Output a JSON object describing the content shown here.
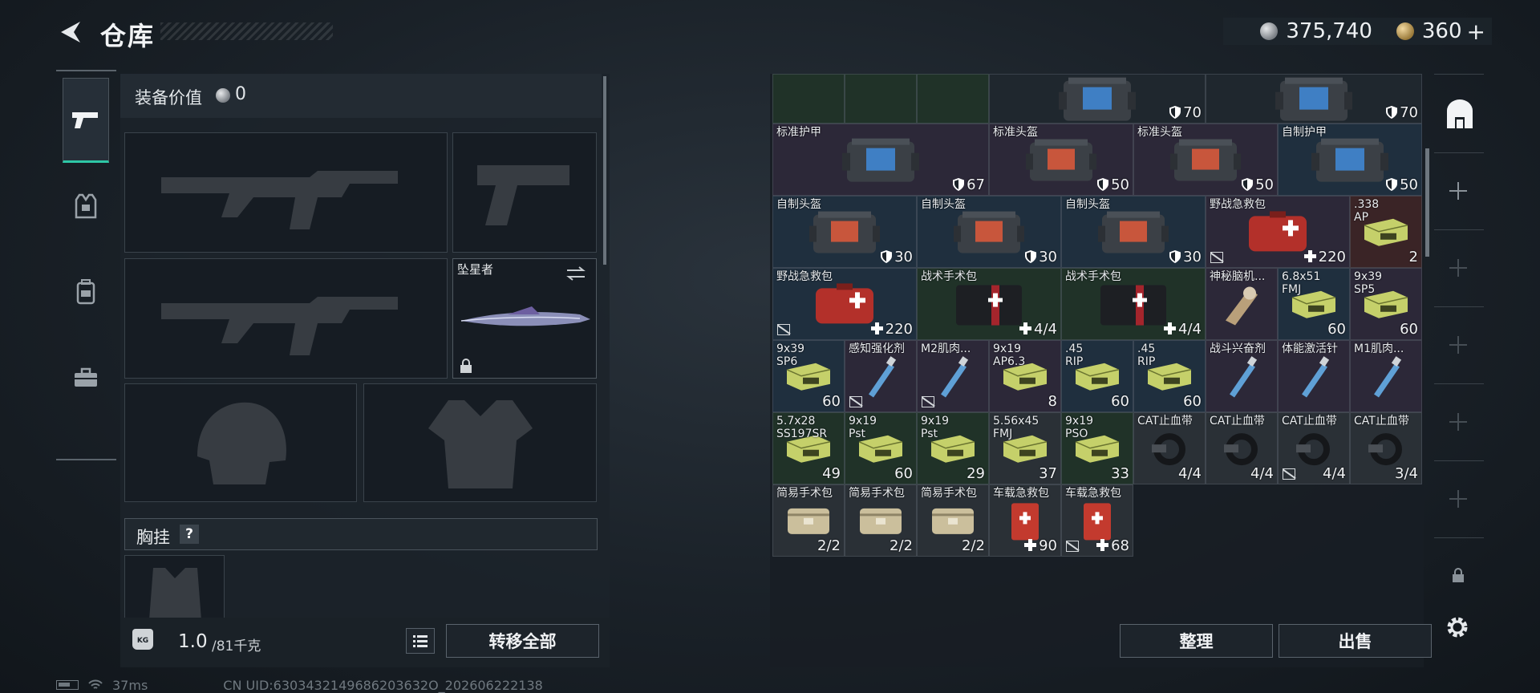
{
  "header": {
    "title": "仓库"
  },
  "currency": {
    "silver_amount": "375,740",
    "gold_amount": "360",
    "gold_plus": "+"
  },
  "equipment": {
    "value_label": "装备价值",
    "value": "0",
    "melee_name": "坠星者",
    "chest_label": "胸挂",
    "help_mark": "?"
  },
  "footer": {
    "weight_icon_text": "KG",
    "weight_current": "1.0",
    "weight_max": "/81千克",
    "transfer_all": "转移全部",
    "sort": "整理",
    "sell": "出售"
  },
  "status": {
    "ping": "37ms",
    "uid": "CN UID:6303432149686203632O_202606222138"
  },
  "storage": {
    "items": [
      {
        "name": "",
        "count": "",
        "bg": "green"
      },
      {
        "name": "",
        "count": "",
        "bg": "green"
      },
      {
        "name": "",
        "count": "",
        "bg": "green"
      },
      {
        "name": "",
        "count": "70",
        "bg": "default",
        "icon": "armor-icon",
        "badge": "shield"
      },
      {
        "name": "",
        "count": "70",
        "bg": "default",
        "icon": "armor-icon",
        "badge": "shield"
      },
      {
        "name": "标准护甲",
        "count": "67",
        "bg": "purple",
        "icon": "armor-icon",
        "badge": "shield"
      },
      {
        "name": "标准头盔",
        "count": "50",
        "bg": "purple",
        "icon": "helmet-icon",
        "badge": "shield"
      },
      {
        "name": "标准头盔",
        "count": "50",
        "bg": "purple",
        "icon": "helmet-icon",
        "badge": "shield"
      },
      {
        "name": "自制护甲",
        "count": "50",
        "bg": "blue",
        "icon": "armor-icon",
        "badge": "shield"
      },
      {
        "name": "自制头盔",
        "count": "30",
        "bg": "blue",
        "icon": "helmet-icon",
        "badge": "shield"
      },
      {
        "name": "自制头盔",
        "count": "30",
        "bg": "blue",
        "icon": "helmet-icon",
        "badge": "shield"
      },
      {
        "name": "自制头盔",
        "count": "30",
        "bg": "blue",
        "icon": "helmet-icon",
        "badge": "shield"
      },
      {
        "name": "野战急救包",
        "count": "220",
        "bg": "purple",
        "icon": "medkit-icon",
        "badge": "plus",
        "nofit": true
      },
      {
        "name": ".338\nAP",
        "count": "2",
        "bg": "red",
        "icon": "ammo-box-icon"
      },
      {
        "name": "野战急救包",
        "count": "220",
        "bg": "blue",
        "icon": "medkit-icon",
        "badge": "plus",
        "nofit": true
      },
      {
        "name": "战术手术包",
        "count": "4/4",
        "bg": "green",
        "icon": "surgery-kit-icon",
        "badge": "plus"
      },
      {
        "name": "战术手术包",
        "count": "4/4",
        "bg": "green",
        "icon": "surgery-kit-icon",
        "badge": "plus"
      },
      {
        "name": "神秘脑机...",
        "count": "",
        "bg": "purple",
        "icon": "brain-chip-icon"
      },
      {
        "name": "6.8x51\nFMJ",
        "count": "60",
        "bg": "blue",
        "icon": "ammo-box-icon"
      },
      {
        "name": "9x39\nSP5",
        "count": "60",
        "bg": "purple",
        "icon": "ammo-box-icon"
      },
      {
        "name": "9x39\nSP6",
        "count": "60",
        "bg": "blue",
        "icon": "ammo-box-icon"
      },
      {
        "name": "感知强化剂",
        "count": "",
        "bg": "purple",
        "icon": "injector-icon",
        "nofit": true
      },
      {
        "name": "M2肌肉...",
        "count": "",
        "bg": "purple",
        "icon": "injector-icon",
        "nofit": true
      },
      {
        "name": "9x19\nAP6.3",
        "count": "8",
        "bg": "purple",
        "icon": "ammo-box-icon"
      },
      {
        "name": ".45\nRIP",
        "count": "60",
        "bg": "blue",
        "icon": "ammo-box-icon"
      },
      {
        "name": ".45\nRIP",
        "count": "60",
        "bg": "blue",
        "icon": "ammo-box-icon"
      },
      {
        "name": "战斗兴奋剂",
        "count": "",
        "bg": "purple",
        "icon": "injector-icon"
      },
      {
        "name": "体能激活针",
        "count": "",
        "bg": "purple",
        "icon": "injector-icon"
      },
      {
        "name": "M1肌肉...",
        "count": "",
        "bg": "purple",
        "icon": "injector-icon"
      },
      {
        "name": "5.7x28\nSS197SR",
        "count": "49",
        "bg": "green",
        "icon": "ammo-box-icon"
      },
      {
        "name": "9x19\nPst",
        "count": "60",
        "bg": "green",
        "icon": "ammo-box-icon"
      },
      {
        "name": "9x19\nPst",
        "count": "29",
        "bg": "green",
        "icon": "ammo-box-icon"
      },
      {
        "name": "5.56x45\nFMJ",
        "count": "37",
        "bg": "grey",
        "icon": "ammo-box-icon"
      },
      {
        "name": "9x19\nPSO",
        "count": "33",
        "bg": "green",
        "icon": "ammo-box-icon"
      },
      {
        "name": "CAT止血带",
        "count": "4/4",
        "bg": "grey",
        "icon": "tourniquet-icon"
      },
      {
        "name": "CAT止血带",
        "count": "4/4",
        "bg": "grey",
        "icon": "tourniquet-icon"
      },
      {
        "name": "CAT止血带",
        "count": "4/4",
        "bg": "grey",
        "icon": "tourniquet-icon",
        "nofit": true
      },
      {
        "name": "CAT止血带",
        "count": "3/4",
        "bg": "grey",
        "icon": "tourniquet-icon"
      },
      {
        "name": "简易手术包",
        "count": "2/2",
        "bg": "grey",
        "icon": "pouch-icon"
      },
      {
        "name": "简易手术包",
        "count": "2/2",
        "bg": "grey",
        "icon": "pouch-icon"
      },
      {
        "name": "简易手术包",
        "count": "2/2",
        "bg": "grey",
        "icon": "pouch-icon"
      },
      {
        "name": "车载急救包",
        "count": "90",
        "bg": "grey",
        "icon": "car-medkit-icon",
        "badge": "plus"
      },
      {
        "name": "车载急救包",
        "count": "68",
        "bg": "grey",
        "icon": "car-medkit-icon",
        "badge": "plus",
        "nofit": true
      }
    ]
  }
}
